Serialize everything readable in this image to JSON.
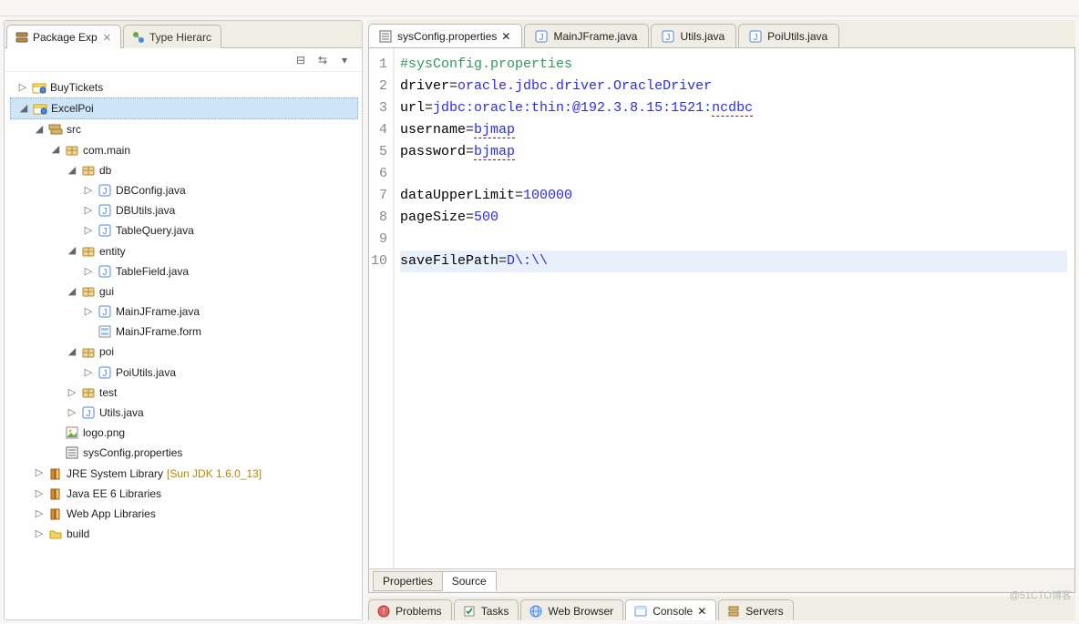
{
  "left_views": {
    "package_explorer": {
      "label": "Package Exp",
      "active": true
    },
    "type_hierarchy": {
      "label": "Type Hierarc",
      "active": false
    }
  },
  "tree": {
    "buytickets": "BuyTickets",
    "excelpoi": "ExcelPoi",
    "src": "src",
    "com_main": "com.main",
    "db": "db",
    "dbconfig": "DBConfig.java",
    "dbutils": "DBUtils.java",
    "tablequery": "TableQuery.java",
    "entity": "entity",
    "tablefield": "TableField.java",
    "gui": "gui",
    "mainjframe_java": "MainJFrame.java",
    "mainjframe_form": "MainJFrame.form",
    "poi": "poi",
    "poiutils": "PoiUtils.java",
    "test": "test",
    "utils_java": "Utils.java",
    "logo_png": "logo.png",
    "sysconfig_prop": "sysConfig.properties",
    "jre_label_a": "JRE System Library ",
    "jre_label_b": "[Sun JDK 1.6.0_13]",
    "javaee": "Java EE 6 Libraries",
    "webapp": "Web App Libraries",
    "build": "build"
  },
  "editor_tabs": [
    {
      "id": "sysconfig",
      "label": "sysConfig.properties",
      "icon": "properties",
      "active": true,
      "closeable": true
    },
    {
      "id": "mainjframe",
      "label": "MainJFrame.java",
      "icon": "java",
      "active": false,
      "closeable": false
    },
    {
      "id": "utils",
      "label": "Utils.java",
      "icon": "java",
      "active": false,
      "closeable": false
    },
    {
      "id": "poiutils",
      "label": "PoiUtils.java",
      "icon": "java",
      "active": false,
      "closeable": false
    }
  ],
  "code_lines": [
    {
      "n": "1",
      "html": "<span class='tok-comment'>#sysConfig.properties</span>"
    },
    {
      "n": "2",
      "html": "<span class='tok-key'>driver</span>=<span class='tok-val'>oracle.jdbc.driver.OracleDriver</span>"
    },
    {
      "n": "3",
      "html": "<span class='tok-key'>url</span>=<span class='tok-val'>jdbc:oracle:thin:@192.3.8.15:1521:<span class='tok-underline'>ncdbc</span></span>"
    },
    {
      "n": "4",
      "html": "<span class='tok-key'>username</span>=<span class='tok-val tok-underline'>bjmap</span>"
    },
    {
      "n": "5",
      "html": "<span class='tok-key'>password</span>=<span class='tok-val tok-underline'>bjmap</span>"
    },
    {
      "n": "6",
      "html": ""
    },
    {
      "n": "7",
      "html": "<span class='tok-key'>dataUpperLimit</span>=<span class='tok-val'>100000</span>"
    },
    {
      "n": "8",
      "html": "<span class='tok-key'>pageSize</span>=<span class='tok-val'>500</span>"
    },
    {
      "n": "9",
      "html": ""
    },
    {
      "n": "10",
      "html": "<span class='tok-key'>saveFilePath</span>=<span class='tok-val'>D\\:\\\\</span>",
      "current": true
    }
  ],
  "bottom_editor_tabs": {
    "properties": "Properties",
    "source": "Source"
  },
  "bottom_views": [
    {
      "id": "problems",
      "label": "Problems",
      "active": false
    },
    {
      "id": "tasks",
      "label": "Tasks",
      "active": false
    },
    {
      "id": "browser",
      "label": "Web Browser",
      "active": false
    },
    {
      "id": "console",
      "label": "Console",
      "active": true,
      "closeable": true
    },
    {
      "id": "servers",
      "label": "Servers",
      "active": false
    }
  ],
  "watermark": "@51CTO博客"
}
